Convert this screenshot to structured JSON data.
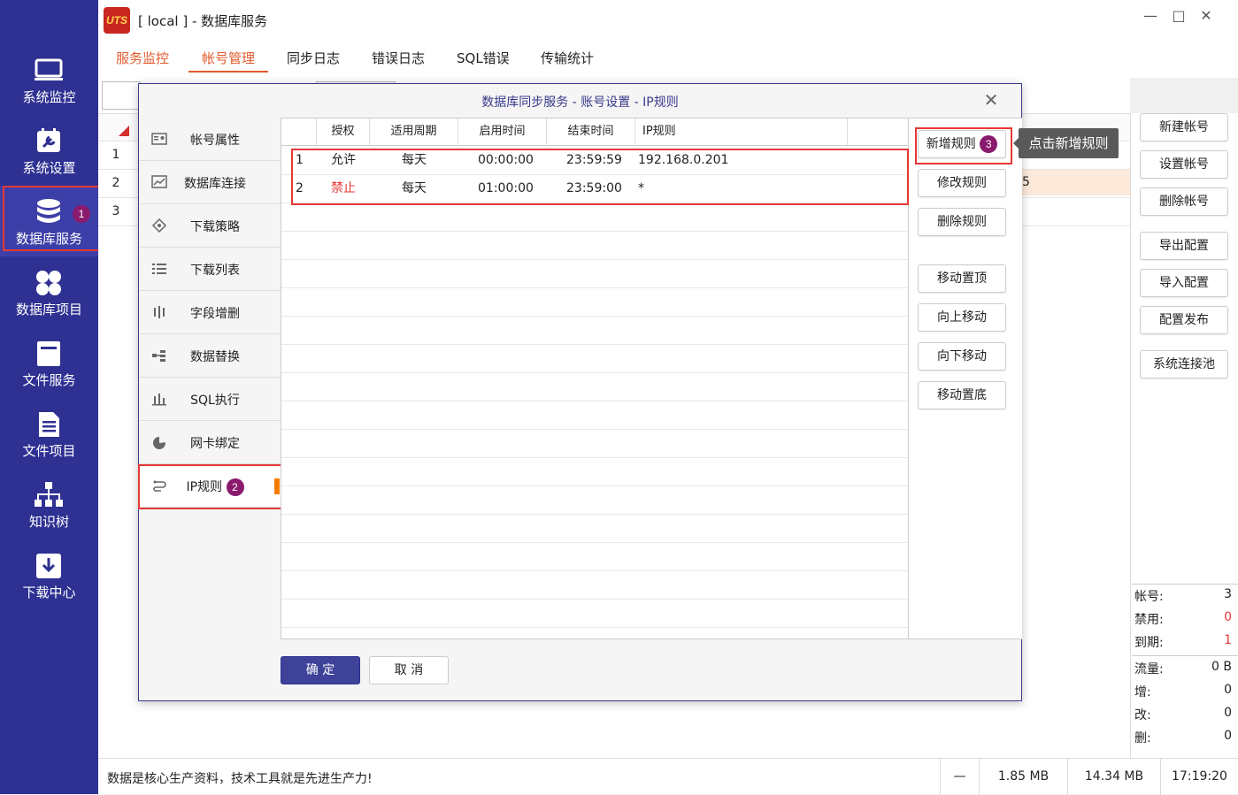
{
  "window": {
    "title": "[ local ] - 数据库服务",
    "logo_text": "UTS"
  },
  "sidebar": {
    "items": [
      {
        "label": "系统监控",
        "icon": "monitor-icon"
      },
      {
        "label": "系统设置",
        "icon": "settings-icon"
      },
      {
        "label": "数据库服务",
        "icon": "database-icon",
        "active": true,
        "badge": "1"
      },
      {
        "label": "数据库项目",
        "icon": "grid-icon"
      },
      {
        "label": "文件服务",
        "icon": "file-box-icon"
      },
      {
        "label": "文件项目",
        "icon": "file-list-icon"
      },
      {
        "label": "知识树",
        "icon": "tree-icon"
      },
      {
        "label": "下载中心",
        "icon": "download-icon"
      }
    ]
  },
  "tabs": [
    {
      "label": "服务监控",
      "active": true
    },
    {
      "label": "帐号管理",
      "active": true,
      "current": true
    },
    {
      "label": "同步日志"
    },
    {
      "label": "错误日志"
    },
    {
      "label": "SQL错误"
    },
    {
      "label": "传输统计"
    }
  ],
  "background_grid": {
    "row_numbers": [
      "1",
      "2",
      "3"
    ],
    "clipped_text": "5"
  },
  "account_buttons": [
    "新建帐号",
    "设置帐号",
    "删除帐号",
    "导出配置",
    "导入配置",
    "配置发布",
    "系统连接池"
  ],
  "stats": {
    "accounts_label": "帐号:",
    "accounts_value": "3",
    "disabled_label": "禁用:",
    "disabled_value": "0",
    "expired_label": "到期:",
    "expired_value": "1",
    "traffic_label": "流量:",
    "traffic_value": "0 B",
    "add_label": "增:",
    "add_value": "0",
    "update_label": "改:",
    "update_value": "0",
    "delete_label": "删:",
    "delete_value": "0"
  },
  "statusbar": {
    "message": "数据是核心生产资料，技术工具就是先进生产力!",
    "dash": "—",
    "mem1": "1.85 MB",
    "mem2": "14.34 MB",
    "time": "17:19:20"
  },
  "dialog": {
    "title": "数据库同步服务 - 账号设置 - IP规则",
    "nav": [
      {
        "label": "帐号属性",
        "icon": "id-card-icon"
      },
      {
        "label": "数据库连接",
        "icon": "chart-connection-icon"
      },
      {
        "label": "下载策略",
        "icon": "diamond-icon"
      },
      {
        "label": "下载列表",
        "icon": "list-icon"
      },
      {
        "label": "字段增删",
        "icon": "columns-icon"
      },
      {
        "label": "数据替换",
        "icon": "replace-icon"
      },
      {
        "label": "SQL执行",
        "icon": "bar-chart-icon"
      },
      {
        "label": "网卡绑定",
        "icon": "pie-chart-icon"
      },
      {
        "label": "IP规则",
        "icon": "ip-rule-icon",
        "selected": true,
        "badge": "2"
      }
    ],
    "table": {
      "headers": [
        "授权",
        "适用周期",
        "启用时间",
        "结束时间",
        "IP规则"
      ],
      "rows": [
        {
          "num": "1",
          "auth": "允许",
          "period": "每天",
          "start": "00:00:00",
          "end": "23:59:59",
          "ip": "192.168.0.201"
        },
        {
          "num": "2",
          "auth": "禁止",
          "period": "每天",
          "start": "01:00:00",
          "end": "23:59:00",
          "ip": "*"
        }
      ]
    },
    "rule_buttons": {
      "add": "新增规则",
      "add_badge": "3",
      "edit": "修改规则",
      "delete": "删除规则",
      "top": "移动置顶",
      "up": "向上移动",
      "down": "向下移动",
      "bottom": "移动置底"
    },
    "tooltip": "点击新增规则",
    "ok": "确 定",
    "cancel": "取 消"
  },
  "colors": {
    "sidebar": "#2e3192",
    "accent": "#e35a2c",
    "highlight_border": "#e53935",
    "badge": "#8a1a6e",
    "deny": "#e53935"
  }
}
